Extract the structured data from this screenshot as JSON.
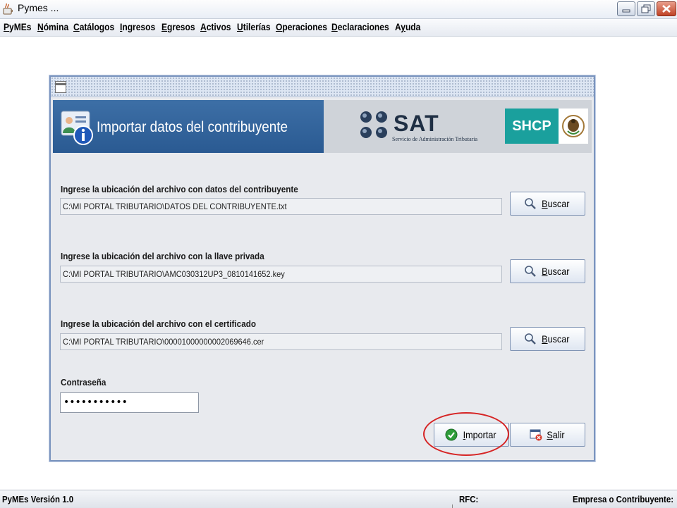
{
  "window": {
    "title": "Pymes ..."
  },
  "menu": {
    "items": [
      {
        "mnemonic": "P",
        "rest": "yMEs"
      },
      {
        "mnemonic": "N",
        "rest": "ómina"
      },
      {
        "mnemonic": "C",
        "rest": "atálogos"
      },
      {
        "mnemonic": "I",
        "rest": "ngresos"
      },
      {
        "mnemonic": "E",
        "rest": "gresos"
      },
      {
        "mnemonic": "A",
        "rest": "ctivos"
      },
      {
        "mnemonic": "U",
        "rest": "tilerías"
      },
      {
        "mnemonic": "O",
        "rest": "peraciones"
      },
      {
        "mnemonic": "D",
        "rest": "eclaraciones"
      },
      {
        "pre": "A",
        "mnemonic": "y",
        "rest": "uda"
      }
    ]
  },
  "dialog": {
    "banner_title": "Importar datos del contribuyente",
    "sat_logo_text": "SAT",
    "sat_subtitle": "Servicio de Administración Tributaria",
    "shcp_text": "SHCP",
    "fields": [
      {
        "label": "Ingrese la ubicación del archivo con datos del contribuyente",
        "value": "C:\\MI PORTAL TRIBUTARIO\\DATOS DEL CONTRIBUYENTE.txt"
      },
      {
        "label": "Ingrese la ubicación del archivo con la llave privada",
        "value": "C:\\MI PORTAL TRIBUTARIO\\AMC030312UP3_0810141652.key"
      },
      {
        "label": "Ingrese la ubicación del archivo con el certificado",
        "value": "C:\\MI PORTAL TRIBUTARIO\\00001000000002069646.cer"
      }
    ],
    "browse_button": {
      "mnemonic": "B",
      "rest": "uscar"
    },
    "password_label": "Contraseña",
    "password_value": "•••••••••••",
    "import_button": {
      "mnemonic": "I",
      "rest": "mportar"
    },
    "exit_button": {
      "mnemonic": "S",
      "rest": "alir"
    }
  },
  "status": {
    "version": "PyMEs Versión 1.0",
    "rfc_label": "RFC:",
    "company_label": "Empresa o Contribuyente:"
  },
  "colors": {
    "banner_blue": "#2f6199",
    "shcp_teal": "#1aa09d",
    "highlight_ring": "#d62424"
  }
}
